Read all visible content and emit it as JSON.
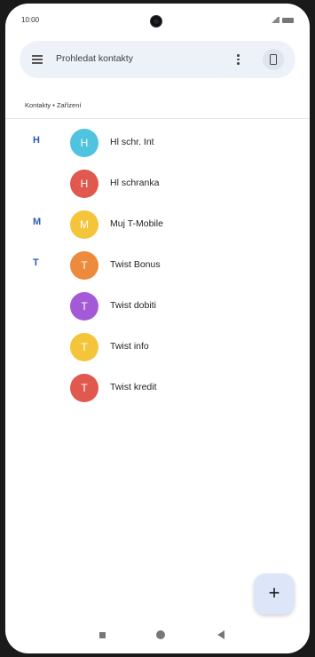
{
  "status_bar": {
    "time": "10:00"
  },
  "search": {
    "placeholder": "Prohledat kontakty"
  },
  "account": {
    "label": "Kontakty • Zařízení"
  },
  "contacts": [
    {
      "header": "H",
      "initial": "H",
      "name": "Hl schr. Int",
      "color": "#4fc3e0"
    },
    {
      "header": "",
      "initial": "H",
      "name": "Hl schranka",
      "color": "#e0584e"
    },
    {
      "header": "M",
      "initial": "M",
      "name": "Muj T-Mobile",
      "color": "#f4c53a"
    },
    {
      "header": "T",
      "initial": "T",
      "name": "Twist Bonus",
      "color": "#ee8a3c"
    },
    {
      "header": "",
      "initial": "T",
      "name": "Twist dobiti",
      "color": "#a45ad6"
    },
    {
      "header": "",
      "initial": "T",
      "name": "Twist info",
      "color": "#f4c53a"
    },
    {
      "header": "",
      "initial": "T",
      "name": "Twist kredit",
      "color": "#e0584e"
    }
  ],
  "fab": {
    "icon": "+",
    "name": "add-contact"
  },
  "nav": {
    "recents": "recents-icon",
    "home": "home-icon",
    "back": "back-icon"
  }
}
